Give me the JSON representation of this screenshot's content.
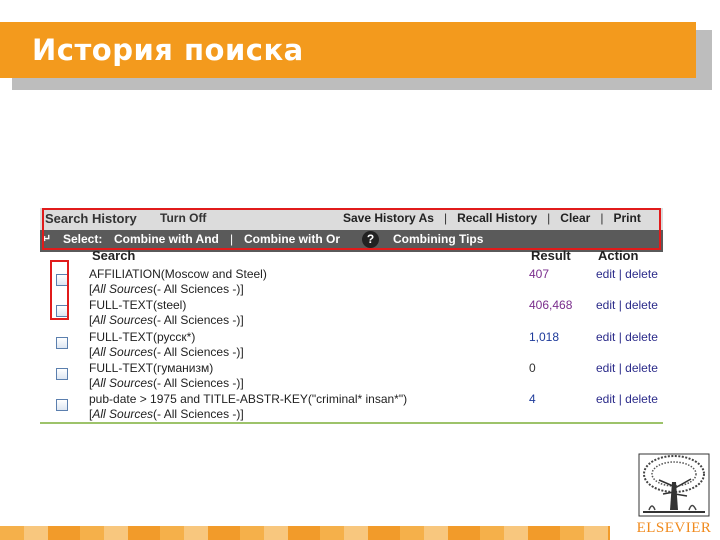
{
  "slide": {
    "title": "История поиска"
  },
  "toolbar": {
    "search_history": "Search History",
    "turn_off": "Turn Off",
    "save_history_as": "Save History As",
    "sep": "|",
    "recall_history": "Recall History",
    "clear": "Clear",
    "print": "Print"
  },
  "select_bar": {
    "back_arrow": "↵",
    "select_label": "Select:",
    "combine_and": "Combine with And",
    "sep": "|",
    "combine_or": "Combine with Or",
    "help_glyph": "?",
    "combining_tips": "Combining Tips"
  },
  "columns": {
    "search": "Search",
    "result": "Result",
    "action": "Action"
  },
  "rows": [
    {
      "query": "AFFILIATION(Moscow and Steel)",
      "sources_open": "[",
      "sources_italic": "All Sources",
      "sources_rest": "(- All Sciences -)]",
      "result": "407",
      "result_color": "#7a2d8c",
      "edit": "edit",
      "sep": "|",
      "delete": "delete"
    },
    {
      "query": "FULL-TEXT(steel)",
      "sources_open": "[",
      "sources_italic": "All Sources",
      "sources_rest": "(- All Sciences -)]",
      "result": "406,468",
      "result_color": "#7a2d8c",
      "edit": "edit",
      "sep": "|",
      "delete": "delete"
    },
    {
      "query": "FULL-TEXT(русск*)",
      "sources_open": "[",
      "sources_italic": "All Sources",
      "sources_rest": "(- All Sciences -)]",
      "result": "1,018",
      "result_color": "#1d3a9a",
      "edit": "edit",
      "sep": "|",
      "delete": "delete"
    },
    {
      "query": "FULL-TEXT(гуманизм)",
      "sources_open": "[",
      "sources_italic": "All Sources",
      "sources_rest": "(- All Sciences -)]",
      "result": "0",
      "result_color": "#333333",
      "edit": "edit",
      "sep": "|",
      "delete": "delete"
    },
    {
      "query": "pub-date > 1975 and TITLE-ABSTR-KEY(\"criminal* insan*\")",
      "sources_open": "[",
      "sources_italic": "All Sources",
      "sources_rest": "(- All Sciences -)]",
      "result": "4",
      "result_color": "#1d3a9a",
      "edit": "edit",
      "sep": "|",
      "delete": "delete"
    }
  ],
  "logo": {
    "text": "ELSEVIER"
  },
  "colors": {
    "accent_orange": "#f39a1d",
    "highlight_red": "#e11b1b",
    "action_link": "#2b2b8a"
  }
}
